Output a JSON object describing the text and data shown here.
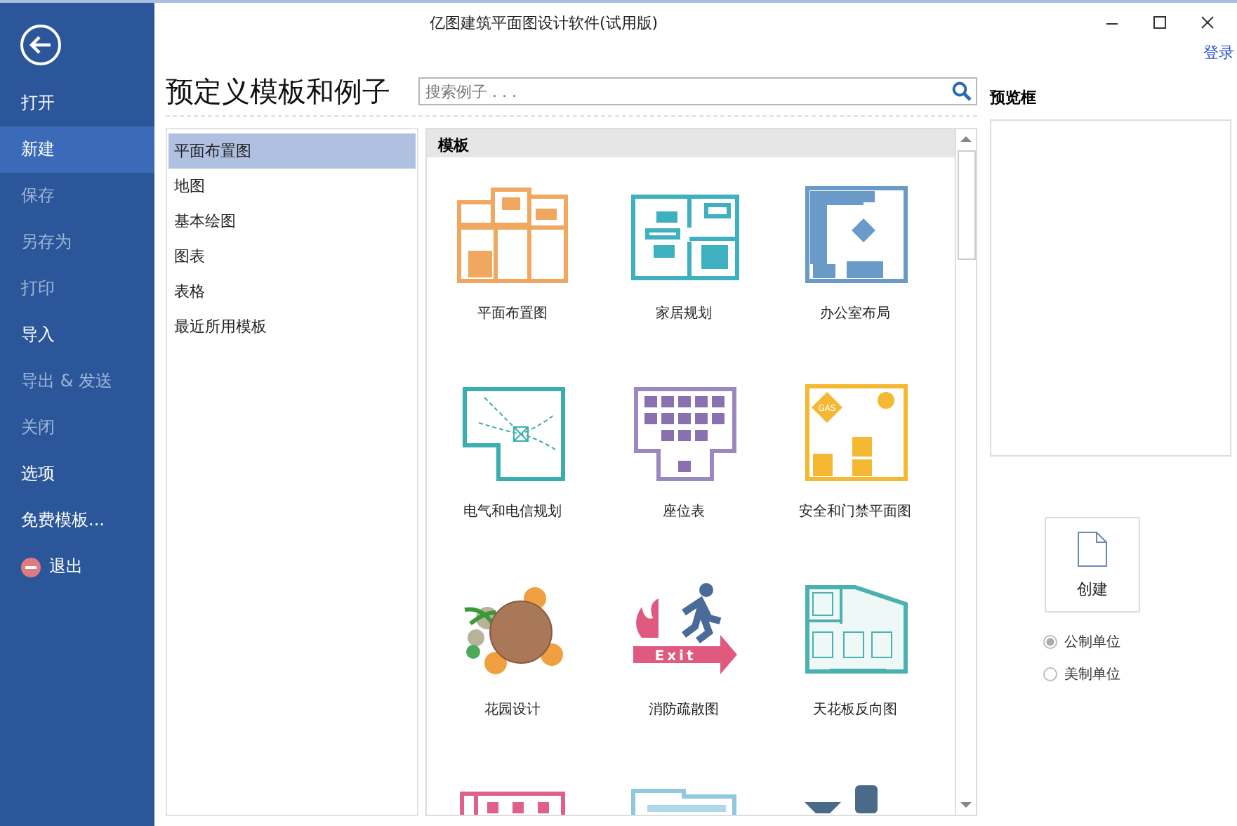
{
  "window": {
    "title": "亿图建筑平面图设计软件(试用版)",
    "login_link": "登录"
  },
  "sidebar": {
    "items": [
      {
        "label": "打开",
        "selected": false,
        "disabled": false,
        "kind": "text"
      },
      {
        "label": "新建",
        "selected": true,
        "disabled": false,
        "kind": "text"
      },
      {
        "label": "保存",
        "selected": false,
        "disabled": true,
        "kind": "text"
      },
      {
        "label": "另存为",
        "selected": false,
        "disabled": true,
        "kind": "text"
      },
      {
        "label": "打印",
        "selected": false,
        "disabled": true,
        "kind": "text"
      },
      {
        "label": "导入",
        "selected": false,
        "disabled": false,
        "kind": "text"
      },
      {
        "label": "导出 & 发送",
        "selected": false,
        "disabled": true,
        "kind": "text"
      },
      {
        "label": "关闭",
        "selected": false,
        "disabled": true,
        "kind": "text"
      },
      {
        "label": "选项",
        "selected": false,
        "disabled": false,
        "kind": "text"
      },
      {
        "label": "免费模板...",
        "selected": false,
        "disabled": false,
        "kind": "text"
      },
      {
        "label": "退出",
        "selected": false,
        "disabled": false,
        "kind": "exit"
      }
    ]
  },
  "heading": "预定义模板和例子",
  "search": {
    "placeholder": "搜索例子 . . ."
  },
  "categories": [
    {
      "label": "平面布置图",
      "selected": true
    },
    {
      "label": "地图",
      "selected": false
    },
    {
      "label": "基本绘图",
      "selected": false
    },
    {
      "label": "图表",
      "selected": false
    },
    {
      "label": "表格",
      "selected": false
    },
    {
      "label": "最近所用模板",
      "selected": false
    }
  ],
  "templates_panel": {
    "header": "模板",
    "items": [
      {
        "kind": "floorplan",
        "label": "平面布置图"
      },
      {
        "kind": "home",
        "label": "家居规划"
      },
      {
        "kind": "office",
        "label": "办公室布局"
      },
      {
        "kind": "electrical",
        "label": "电气和电信规划"
      },
      {
        "kind": "seating",
        "label": "座位表"
      },
      {
        "kind": "security",
        "label": "安全和门禁平面图",
        "icon_text": "GAS"
      },
      {
        "kind": "garden",
        "label": "花园设计"
      },
      {
        "kind": "evacuation",
        "label": "消防疏散图",
        "icon_text": "Exit"
      },
      {
        "kind": "ceiling",
        "label": "天花板反向图"
      },
      {
        "kind": "pinkplan"
      },
      {
        "kind": "blueplan"
      },
      {
        "kind": "kitchen"
      }
    ]
  },
  "preview": {
    "label": "预览框"
  },
  "create_button": {
    "label": "创建"
  },
  "units": [
    {
      "label": "公制单位",
      "selected": true
    },
    {
      "label": "美制单位",
      "selected": false
    }
  ]
}
